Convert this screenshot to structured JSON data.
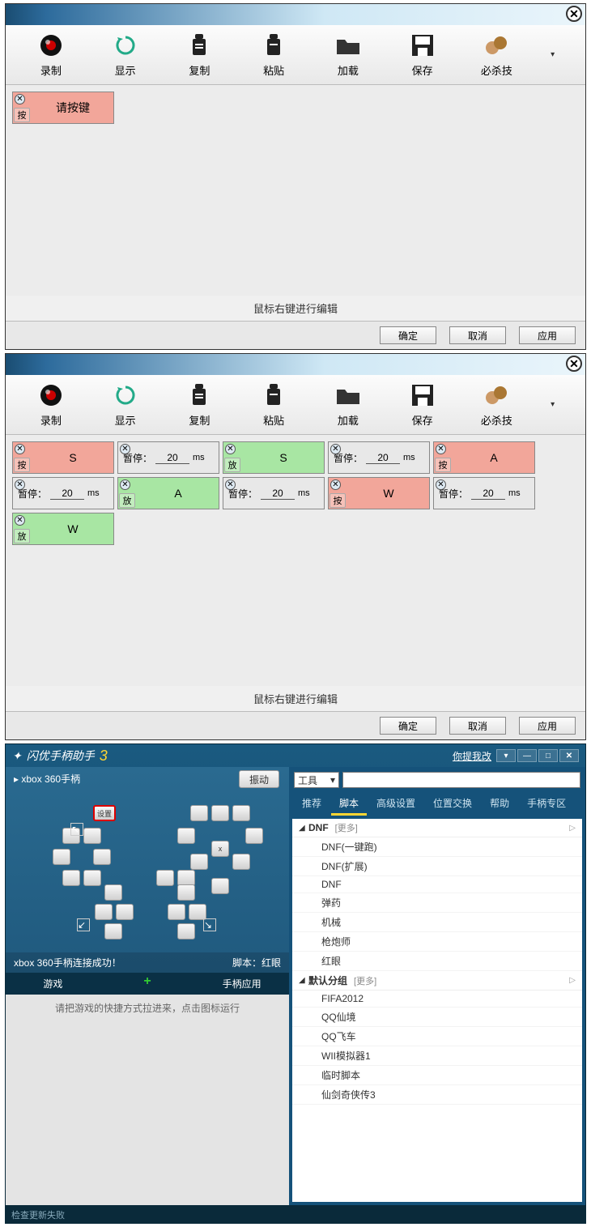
{
  "dialog1": {
    "toolbar": [
      {
        "label": "录制",
        "icon": "record"
      },
      {
        "label": "显示",
        "icon": "refresh"
      },
      {
        "label": "复制",
        "icon": "copy"
      },
      {
        "label": "粘贴",
        "icon": "paste"
      },
      {
        "label": "加载",
        "icon": "folder"
      },
      {
        "label": "保存",
        "icon": "save"
      },
      {
        "label": "必杀技",
        "icon": "combo"
      }
    ],
    "block": {
      "tag": "按",
      "label": "请按键"
    },
    "hint": "鼠标右键进行编辑",
    "buttons": {
      "ok": "确定",
      "cancel": "取消",
      "apply": "应用"
    }
  },
  "dialog2": {
    "toolbar": [
      {
        "label": "录制",
        "icon": "record"
      },
      {
        "label": "显示",
        "icon": "refresh"
      },
      {
        "label": "复制",
        "icon": "copy"
      },
      {
        "label": "粘贴",
        "icon": "paste"
      },
      {
        "label": "加载",
        "icon": "folder"
      },
      {
        "label": "保存",
        "icon": "save"
      },
      {
        "label": "必杀技",
        "icon": "combo"
      }
    ],
    "blocks": [
      {
        "type": "red",
        "tag": "按",
        "key": "S"
      },
      {
        "type": "pause",
        "tag": "暂停：",
        "val": "20",
        "unit": "ms"
      },
      {
        "type": "green",
        "tag": "放",
        "key": "S"
      },
      {
        "type": "pause",
        "tag": "暂停：",
        "val": "20",
        "unit": "ms"
      },
      {
        "type": "red",
        "tag": "按",
        "key": "A"
      },
      {
        "type": "pause",
        "tag": "暂停：",
        "val": "20",
        "unit": "ms"
      },
      {
        "type": "green",
        "tag": "放",
        "key": "A"
      },
      {
        "type": "pause",
        "tag": "暂停：",
        "val": "20",
        "unit": "ms"
      },
      {
        "type": "red",
        "tag": "按",
        "key": "W"
      },
      {
        "type": "pause",
        "tag": "暂停：",
        "val": "20",
        "unit": "ms"
      },
      {
        "type": "green",
        "tag": "放",
        "key": "W"
      }
    ],
    "hint": "鼠标右键进行编辑",
    "buttons": {
      "ok": "确定",
      "cancel": "取消",
      "apply": "应用"
    }
  },
  "app": {
    "title": "闪优手柄助手",
    "version": "3",
    "notice": "你提我改",
    "device": "xbox 360手柄",
    "vibrate": "振动",
    "status_left": "xbox 360手柄连接成功！",
    "status_right": "脚本：红眼",
    "left_tabs": {
      "game": "游戏",
      "add": "+",
      "app": "手柄应用"
    },
    "drop_hint": "请把游戏的快捷方式拉进来，点击图标运行",
    "tools_label": "工具",
    "nav_tabs": [
      "推荐",
      "脚本",
      "高级设置",
      "位置交换",
      "帮助",
      "手柄专区"
    ],
    "active_tab": 1,
    "tree": [
      {
        "group": "DNF",
        "more": "[更多]",
        "items": [
          "DNF(一键跑)",
          "DNF(扩展)",
          "DNF",
          "弹药",
          "机械",
          "枪炮师",
          "红眼"
        ]
      },
      {
        "group": "默认分组",
        "more": "[更多]",
        "items": [
          "FIFA2012",
          "QQ仙境",
          "QQ飞车",
          "WII模拟器1",
          "临时脚本",
          "仙剑奇侠传3"
        ]
      }
    ],
    "statusbar": "检查更新失败"
  }
}
